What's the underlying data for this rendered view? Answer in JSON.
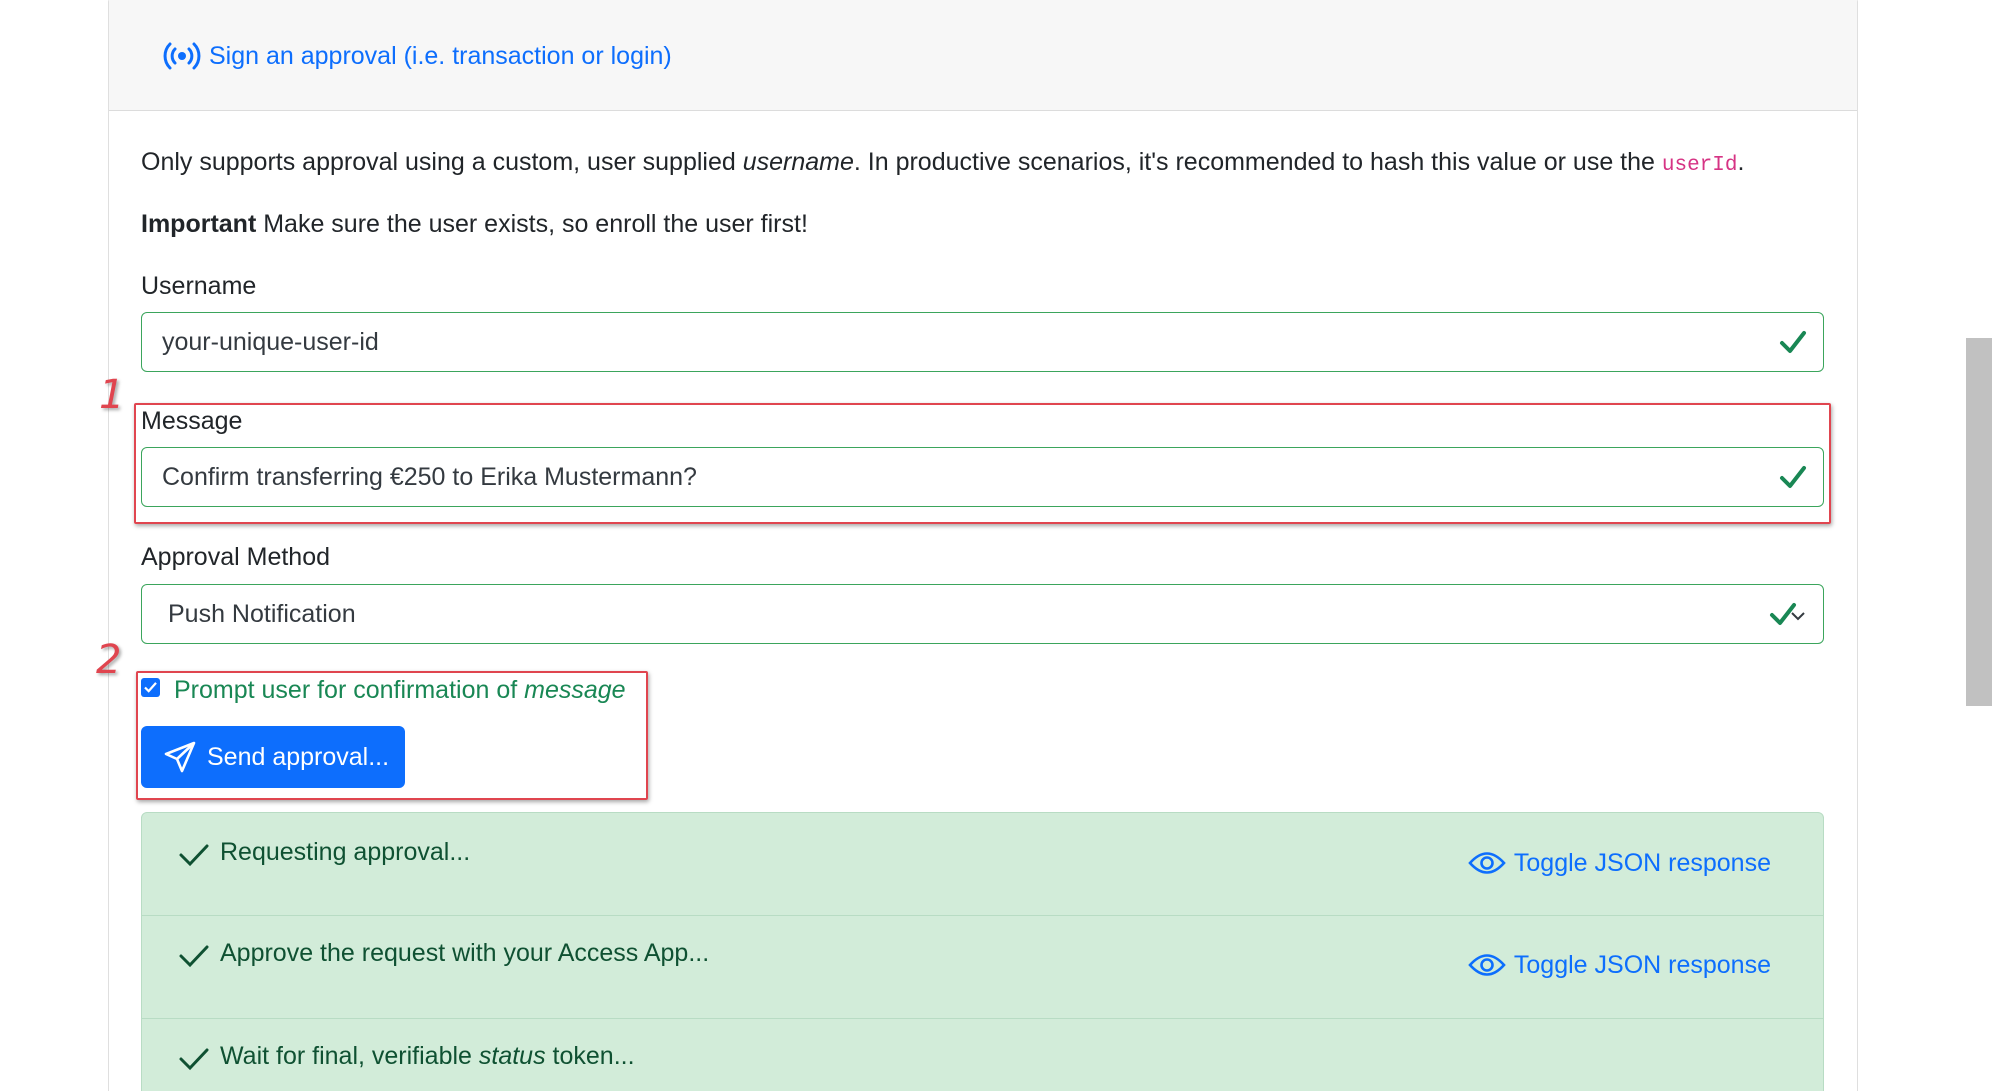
{
  "header": {
    "link_label": "Sign an approval (i.e. transaction or login)"
  },
  "intro": {
    "part1": "Only supports approval using a custom, user supplied ",
    "em": "username",
    "part2": ". In productive scenarios, it's recommended to hash this value or use the ",
    "code": "userId",
    "part3": "."
  },
  "important": {
    "bold": "Important",
    "text": " Make sure the user exists, so enroll the user first!"
  },
  "form": {
    "username_label": "Username",
    "username_value": "your-unique-user-id",
    "message_label": "Message",
    "message_value": "Confirm transferring €250 to Erika Mustermann?",
    "method_label": "Approval Method",
    "method_value": "Push Notification",
    "confirm_label": "Prompt user for confirmation of ",
    "confirm_em": "message",
    "confirm_checked": true,
    "send_label": "Send approval..."
  },
  "annotations": [
    "1",
    "2"
  ],
  "steps": [
    {
      "text": "Requesting approval...",
      "toggle": "Toggle JSON response"
    },
    {
      "text": "Approve the request with your Access App...",
      "toggle": "Toggle JSON response"
    },
    {
      "text_pre": "Wait for final, verifiable ",
      "text_em": "status",
      "text_post": " token..."
    }
  ],
  "colors": {
    "accent": "#0d6efd",
    "success": "#198754",
    "success_bg": "#d2ecd9",
    "annotation": "#e0454f",
    "code": "#d63384"
  }
}
